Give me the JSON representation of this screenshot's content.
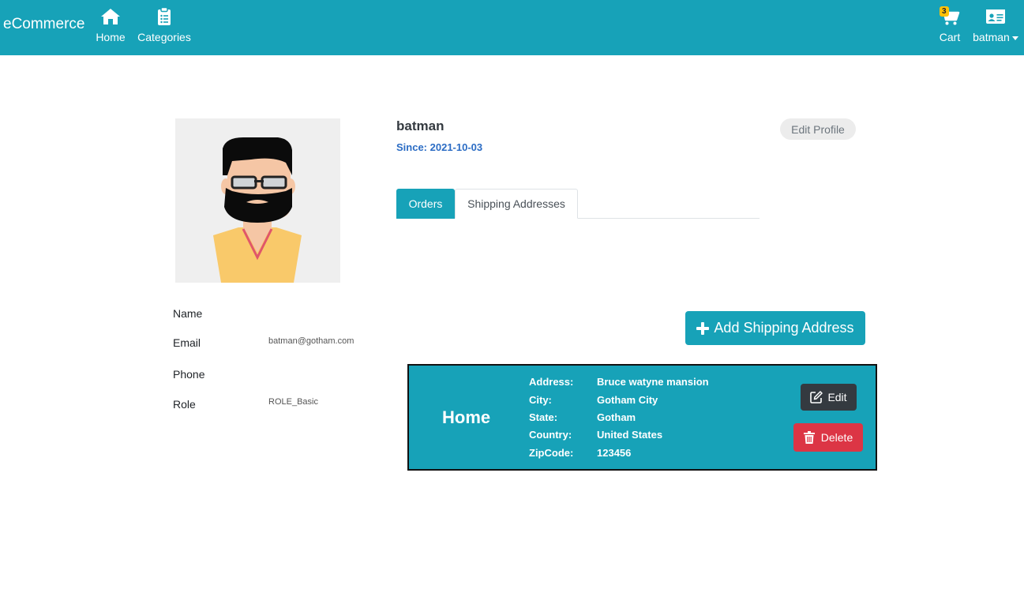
{
  "navbar": {
    "brand": "eCommerce",
    "home_label": "Home",
    "categories_label": "Categories",
    "cart_label": "Cart",
    "cart_count": "3",
    "user_label": "batman",
    "bg_color": "#17a2b8",
    "icons": {
      "home": "home-icon",
      "categories": "clipboard-list-icon",
      "cart": "cart-icon",
      "user": "id-card-icon"
    }
  },
  "profile": {
    "username": "batman",
    "since": "Since: 2021-10-03",
    "edit_profile_label": "Edit Profile",
    "fields": [
      {
        "label": "Name",
        "value": ""
      },
      {
        "label": "Email",
        "value": "batman@gotham.com"
      },
      {
        "label": "Phone",
        "value": ""
      },
      {
        "label": "Role",
        "value": "ROLE_Basic"
      }
    ]
  },
  "tabs": [
    {
      "label": "Orders",
      "active": true
    },
    {
      "label": "Shipping Addresses",
      "active": false
    }
  ],
  "shipping": {
    "add_button_label": "Add Shipping Address",
    "address_card": {
      "title": "Home",
      "fields": [
        {
          "label": "Address:",
          "value": "Bruce watyne mansion"
        },
        {
          "label": "City:",
          "value": "Gotham City"
        },
        {
          "label": "State:",
          "value": "Gotham"
        },
        {
          "label": "Country:",
          "value": "United States"
        },
        {
          "label": "ZipCode:",
          "value": "123456"
        }
      ],
      "edit_label": "Edit",
      "delete_label": "Delete"
    }
  },
  "colors": {
    "primary": "#17a2b8",
    "dark": "#343a40",
    "danger": "#dc3545",
    "badge": "#ffc107",
    "link": "#2b6cc4"
  }
}
